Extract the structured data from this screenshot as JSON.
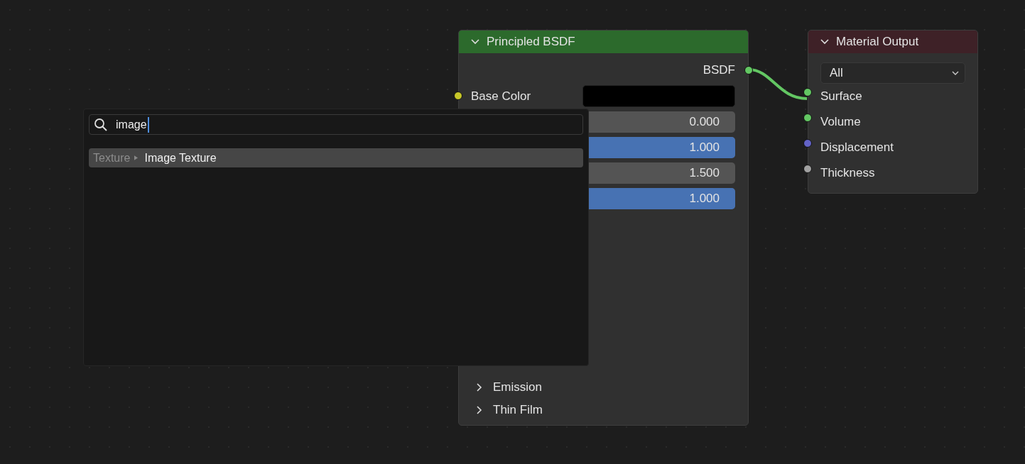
{
  "principled_node": {
    "title": "Principled BSDF",
    "expanded": true,
    "outputs": [
      {
        "label": "BSDF",
        "color": "#63c763"
      }
    ],
    "inputs": [
      {
        "label": "Base Color",
        "color": "#c7c729",
        "swatch": {
          "color": "#000000"
        }
      }
    ],
    "fields": [
      {
        "kind": "number",
        "value": "0.000"
      },
      {
        "kind": "slider",
        "value": "1.000",
        "level": 1
      },
      {
        "kind": "number",
        "value": "1.500"
      },
      {
        "kind": "slider",
        "value": "1.000",
        "level": 1
      }
    ],
    "panels": [
      {
        "label": "Emission",
        "expanded": false
      },
      {
        "label": "Thin Film",
        "expanded": false
      }
    ]
  },
  "material_output_node": {
    "title": "Material Output",
    "expanded": true,
    "dropdown": {
      "value": "All"
    },
    "inputs": [
      {
        "label": "Surface",
        "color": "#63c763"
      },
      {
        "label": "Volume",
        "color": "#63c763"
      },
      {
        "label": "Displacement",
        "color": "#6363c7"
      },
      {
        "label": "Thickness",
        "color": "#a1a1a1"
      }
    ]
  },
  "search_popup": {
    "query": "image",
    "results": [
      {
        "category": "Texture",
        "label": "Image Texture",
        "selected": true
      }
    ]
  }
}
